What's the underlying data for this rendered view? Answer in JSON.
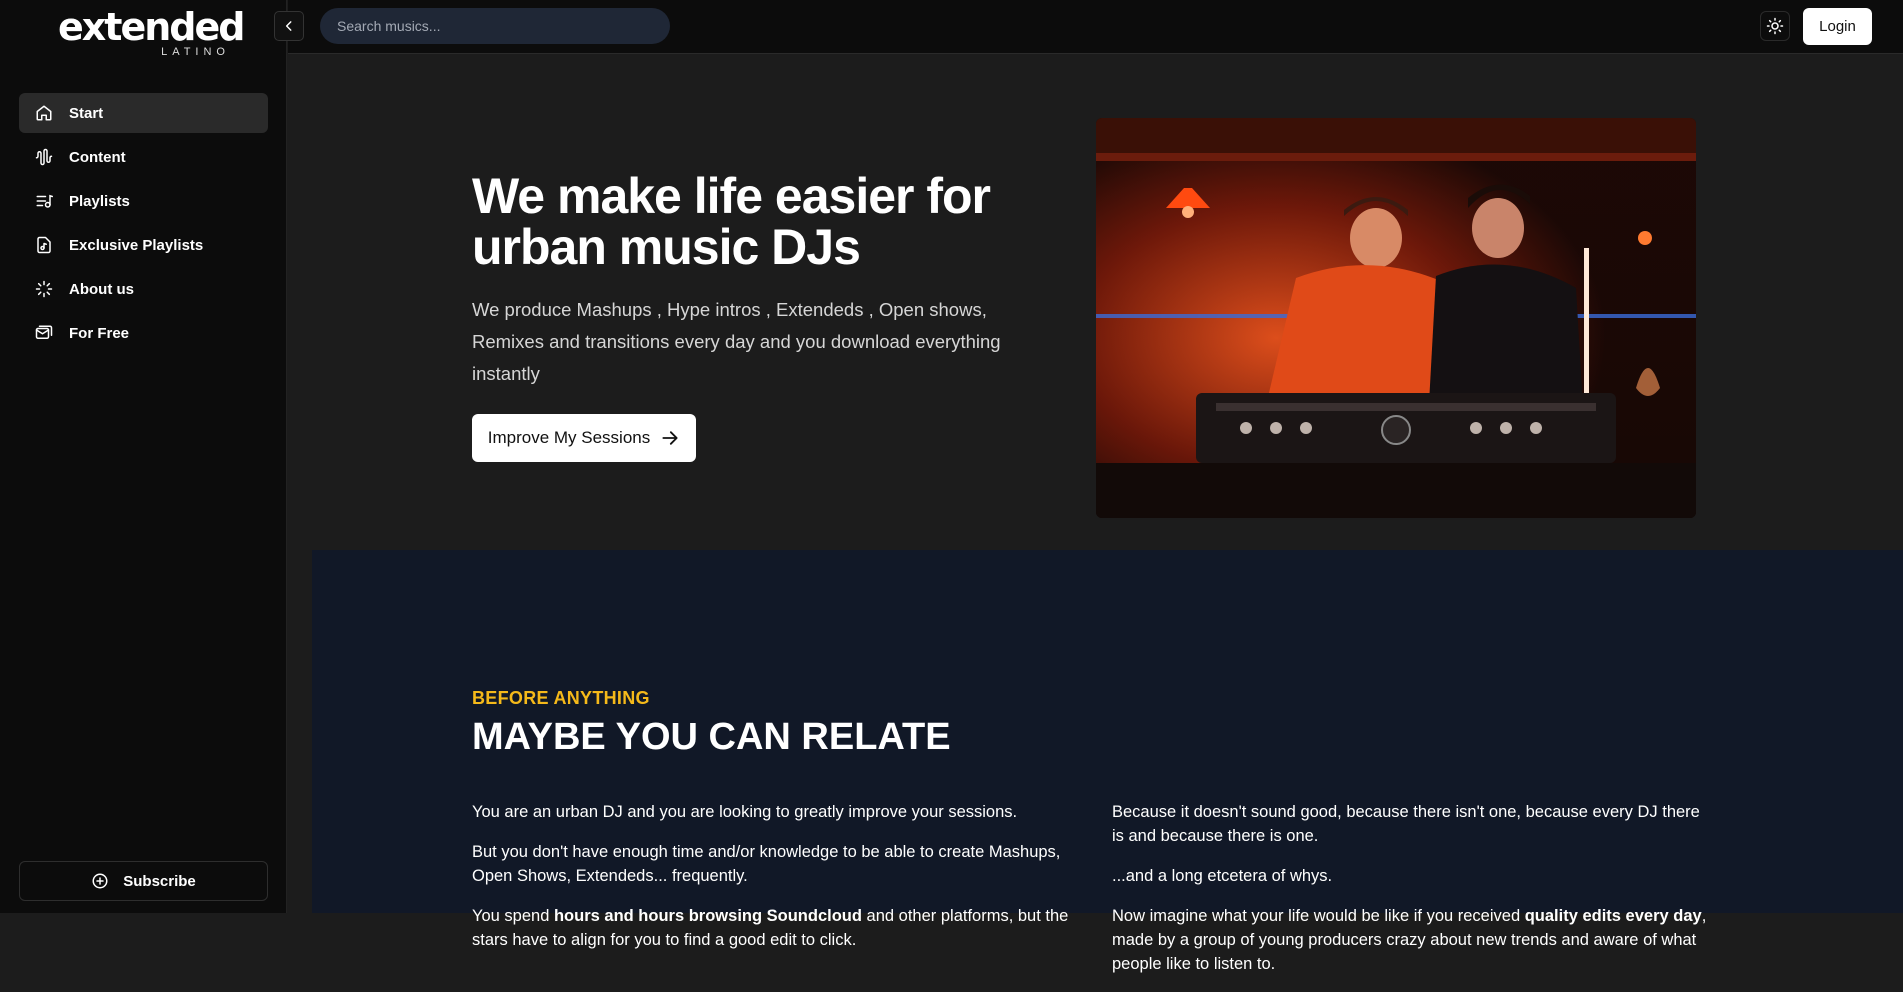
{
  "brand": {
    "name": "extended",
    "sub": "LATINO"
  },
  "sidebar": {
    "items": [
      {
        "label": "Start",
        "icon": "home-icon",
        "active": true
      },
      {
        "label": "Content",
        "icon": "waveform-icon",
        "active": false
      },
      {
        "label": "Playlists",
        "icon": "playlist-icon",
        "active": false
      },
      {
        "label": "Exclusive Playlists",
        "icon": "music-file-icon",
        "active": false
      },
      {
        "label": "About us",
        "icon": "loader-icon",
        "active": false
      },
      {
        "label": "For Free",
        "icon": "mail-icon",
        "active": false
      }
    ],
    "subscribe_label": "Subscribe"
  },
  "topbar": {
    "search_placeholder": "Search musics...",
    "login_label": "Login"
  },
  "hero": {
    "title": "We make life easier for urban music DJs",
    "text": "We produce Mashups , Hype intros , Extendeds , Open shows, Remixes and transitions every day and you download everything instantly",
    "cta_label": "Improve My Sessions"
  },
  "relate": {
    "kicker": "BEFORE ANYTHING",
    "title": "MAYBE YOU CAN RELATE",
    "left": {
      "p1": "You are an urban DJ and you are looking to greatly improve your sessions.",
      "p2": "But you don't have enough time and/or knowledge to be able to create Mashups, Open Shows, Extendeds... frequently.",
      "p3_before": "You spend ",
      "p3_bold": "hours and hours browsing Soundcloud",
      "p3_after": " and other platforms, but the stars have to align for you to find a good edit to click."
    },
    "right": {
      "p1": "Because it doesn't sound good, because there isn't one, because every DJ there is and because there is one.",
      "p2": "...and a long etcetera of whys.",
      "p3_before": "Now imagine what your life would be like if you received ",
      "p3_bold": "quality edits every day",
      "p3_after": ", made by a group of young producers crazy about new trends and aware of what people like to listen to."
    }
  },
  "colors": {
    "accent": "#f5b91a",
    "sidebar_bg": "#0c0c0c",
    "content_bg": "#1c1c1c",
    "section_bg": "#111827"
  }
}
